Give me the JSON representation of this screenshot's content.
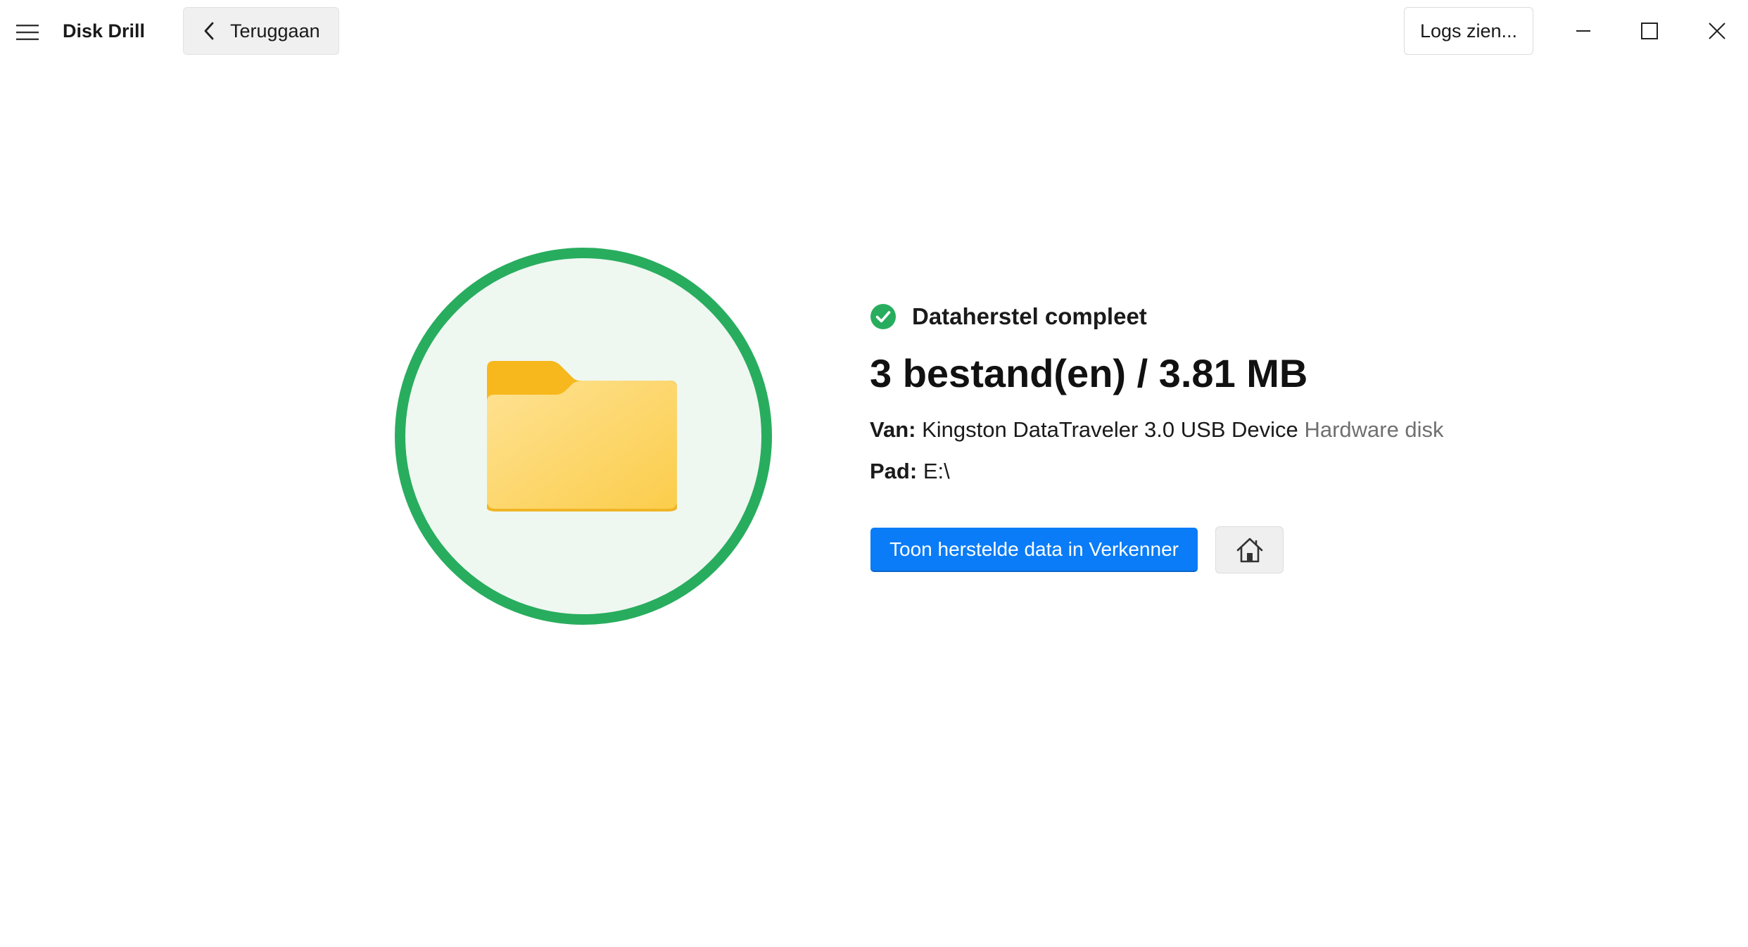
{
  "app": {
    "title": "Disk Drill"
  },
  "toolbar": {
    "back_label": "Teruggaan",
    "logs_label": "Logs zien..."
  },
  "icons": {
    "menu": "hamburger-menu-icon",
    "back": "chevron-left-icon",
    "minimize": "minimize-icon",
    "maximize": "maximize-icon",
    "close": "close-icon",
    "status": "check-circle-icon",
    "hero": "folder-icon",
    "home": "home-icon"
  },
  "colors": {
    "accent_green": "#28ad5e",
    "circle_fill": "#eff7f1",
    "primary_button": "#0a7cf7",
    "folder_back": "#f7b81d",
    "folder_front": "#fdd66b"
  },
  "result": {
    "status": "Dataherstel compleet",
    "summary": "3 bestand(en) / 3.81 MB",
    "from_label": "Van:",
    "from_device": "Kingston DataTraveler 3.0 USB Device",
    "from_type": "Hardware disk",
    "path_label": "Pad:",
    "path_value": "E:\\"
  },
  "actions": {
    "show_in_explorer": "Toon herstelde data in Verkenner"
  }
}
